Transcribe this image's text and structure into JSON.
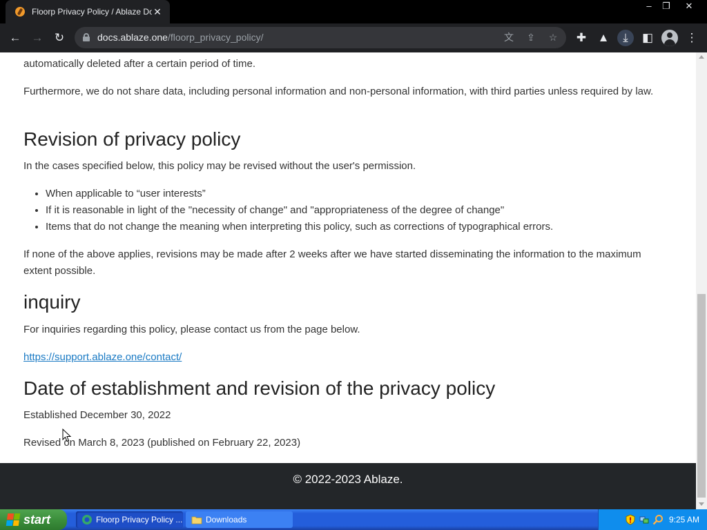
{
  "browser": {
    "tab_title": "Floorp Privacy Policy / Ablaze Docs",
    "url_host": "docs.ablaze.one",
    "url_path": "/floorp_privacy_policy/"
  },
  "article": {
    "top_partial_line": "automatically deleted after a certain period of time.",
    "sharing_paragraph": "Furthermore, we do not share data, including personal information and non-personal information, with third parties unless required by law.",
    "revision": {
      "heading": "Revision of privacy policy",
      "intro": "In the cases specified below, this policy may be revised without the user's permission.",
      "items": [
        "When applicable to “user interests”",
        "If it is reasonable in light of the \"necessity of change\" and \"appropriateness of the degree of change\"",
        "Items that do not change the meaning when interpreting this policy, such as corrections of typographical errors."
      ],
      "note": "If none of the above applies, revisions may be made after 2 weeks after we have started disseminating the information to the maximum extent possible."
    },
    "inquiry": {
      "heading": "inquiry",
      "text": "For inquiries regarding this policy, please contact us from the page below.",
      "link": "https://support.ablaze.one/contact/"
    },
    "dates": {
      "heading": "Date of establishment and revision of the privacy policy",
      "established": "Established December 30, 2022",
      "revised": "Revised on March 8, 2023 (published on February 22, 2023)"
    }
  },
  "footer": {
    "copyright": "© 2022-2023 Ablaze."
  },
  "taskbar": {
    "start_label": "start",
    "tasks": [
      {
        "label": "Floorp Privacy Policy ..."
      },
      {
        "label": "Downloads"
      }
    ],
    "clock": "9:25 AM"
  },
  "colors": {
    "link": "#1a7ac4",
    "footer_bg": "#232629",
    "browser_toolbar": "#202124",
    "taskbar": "#245edb",
    "start_button": "#3c8f3c"
  }
}
